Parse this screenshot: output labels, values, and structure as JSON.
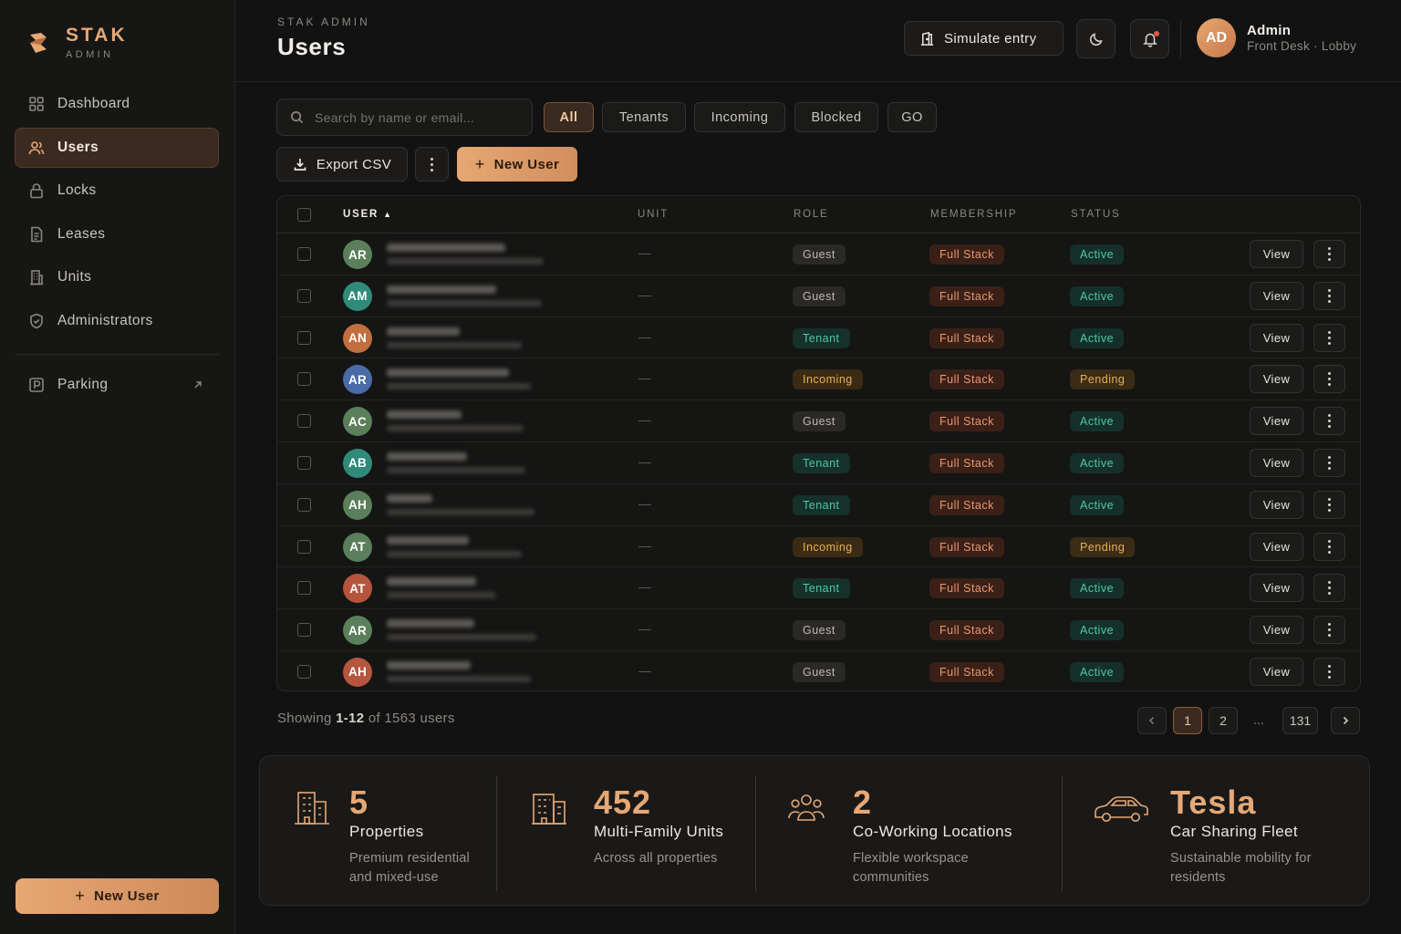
{
  "brand": {
    "name": "STAK",
    "sub": "ADMIN"
  },
  "sidebar": {
    "items": [
      {
        "label": "Dashboard",
        "icon": "grid-icon"
      },
      {
        "label": "Users",
        "icon": "users-icon",
        "active": true
      },
      {
        "label": "Locks",
        "icon": "lock-icon"
      },
      {
        "label": "Leases",
        "icon": "document-icon"
      },
      {
        "label": "Units",
        "icon": "building-icon"
      },
      {
        "label": "Administrators",
        "icon": "shield-icon"
      }
    ],
    "secondary": [
      {
        "label": "Parking",
        "icon": "parking-icon",
        "external": true
      }
    ],
    "new_user_label": "New User"
  },
  "header": {
    "eyebrow": "STAK ADMIN",
    "title": "Users",
    "simulate_label": "Simulate entry",
    "user": {
      "initials": "AD",
      "name": "Admin",
      "location": "Front Desk · Lobby"
    }
  },
  "toolbar": {
    "search_placeholder": "Search by name or email...",
    "filters": [
      "All",
      "Tenants",
      "Incoming",
      "Blocked",
      "GO"
    ],
    "active_filter": "All",
    "export_label": "Export CSV",
    "new_user_label": "New User"
  },
  "table": {
    "columns": {
      "user": "USER",
      "unit": "UNIT",
      "role": "ROLE",
      "membership": "MEMBERSHIP",
      "status": "STATUS"
    },
    "view_label": "View",
    "rows": [
      {
        "initials": "AR",
        "color": "#5b7f5a",
        "unit": "—",
        "role": "Guest",
        "membership": "Full Stack",
        "status": "Active"
      },
      {
        "initials": "AM",
        "color": "#2f8a7a",
        "unit": "—",
        "role": "Guest",
        "membership": "Full Stack",
        "status": "Active"
      },
      {
        "initials": "AN",
        "color": "#c16f3f",
        "unit": "—",
        "role": "Tenant",
        "membership": "Full Stack",
        "status": "Active"
      },
      {
        "initials": "AR",
        "color": "#4b6aa8",
        "unit": "—",
        "role": "Incoming",
        "membership": "Full Stack",
        "status": "Pending"
      },
      {
        "initials": "AC",
        "color": "#5b7f5a",
        "unit": "—",
        "role": "Guest",
        "membership": "Full Stack",
        "status": "Active"
      },
      {
        "initials": "AB",
        "color": "#2f8a7a",
        "unit": "—",
        "role": "Tenant",
        "membership": "Full Stack",
        "status": "Active"
      },
      {
        "initials": "AH",
        "color": "#5b7f5a",
        "unit": "—",
        "role": "Tenant",
        "membership": "Full Stack",
        "status": "Active"
      },
      {
        "initials": "AT",
        "color": "#5b7f5a",
        "unit": "—",
        "role": "Incoming",
        "membership": "Full Stack",
        "status": "Pending"
      },
      {
        "initials": "AT",
        "color": "#b5553e",
        "unit": "—",
        "role": "Tenant",
        "membership": "Full Stack",
        "status": "Active"
      },
      {
        "initials": "AR",
        "color": "#5b7f5a",
        "unit": "—",
        "role": "Guest",
        "membership": "Full Stack",
        "status": "Active"
      },
      {
        "initials": "AH",
        "color": "#b5553e",
        "unit": "—",
        "role": "Guest",
        "membership": "Full Stack",
        "status": "Active"
      }
    ]
  },
  "pagination": {
    "showing_prefix": "Showing",
    "range": "1-12",
    "of_text": "of",
    "total": "1563",
    "suffix": "users",
    "pages": [
      "1",
      "2",
      "131"
    ],
    "ellipsis": "...",
    "current": "1"
  },
  "stats": [
    {
      "value": "5",
      "label": "Properties",
      "desc": "Premium residential and mixed-use",
      "icon": "building-icon"
    },
    {
      "value": "452",
      "label": "Multi-Family Units",
      "desc": "Across all properties",
      "icon": "apartment-icon"
    },
    {
      "value": "2",
      "label": "Co-Working Locations",
      "desc": "Flexible workspace communities",
      "icon": "people-icon"
    },
    {
      "value": "Tesla",
      "label": "Car Sharing Fleet",
      "desc": "Sustainable mobility for residents",
      "icon": "car-icon"
    }
  ],
  "colors": {
    "accent": "#e6a876",
    "background": "#121212"
  }
}
